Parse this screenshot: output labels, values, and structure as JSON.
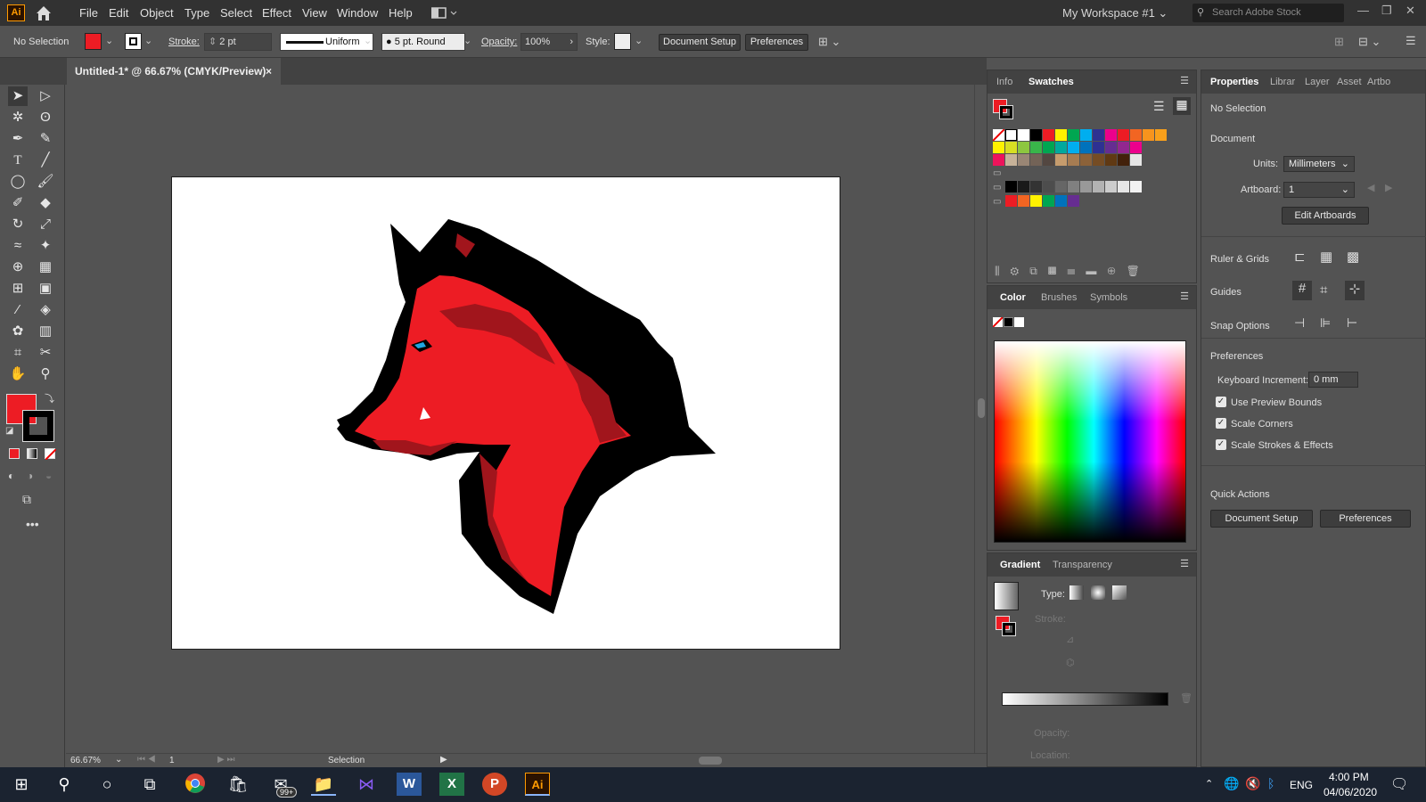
{
  "app": {
    "logo_text": "Ai",
    "menu": [
      "File",
      "Edit",
      "Object",
      "Type",
      "Select",
      "Effect",
      "View",
      "Window",
      "Help"
    ],
    "workspace": "My Workspace #1",
    "search_placeholder": "Search Adobe Stock"
  },
  "controlbar": {
    "selection": "No Selection",
    "stroke_label": "Stroke:",
    "stroke_weight": "2 pt",
    "stroke_profile": "Uniform",
    "brush": "5 pt. Round",
    "opacity_label": "Opacity:",
    "opacity": "100%",
    "style_label": "Style:",
    "document_setup": "Document Setup",
    "preferences": "Preferences"
  },
  "document": {
    "tab_title": "Untitled-1* @ 66.67% (CMYK/Preview)",
    "close": "×",
    "zoom": "66.67%",
    "artboard_num": "1",
    "status_tool": "Selection"
  },
  "swatches_panel": {
    "tabs": [
      "Info",
      "Swatches"
    ],
    "active": "Swatches",
    "colors_row1": [
      "#ffffff",
      "#000000",
      "#ed1c24",
      "#fff200",
      "#00a651",
      "#00aeef",
      "#2e3192",
      "#ec008c",
      "#ed1c24",
      "#f26522",
      "#f7941d",
      "#f9a01b"
    ],
    "colors_row2": [
      "#fff200",
      "#d7df23",
      "#8dc63f",
      "#39b54a",
      "#00a651",
      "#00a99d",
      "#00aeef",
      "#0072bc",
      "#2e3192",
      "#662d91",
      "#92278f",
      "#ec008c"
    ],
    "colors_row3": [
      "#ed145b",
      "#c7b299",
      "#998675",
      "#736357",
      "#534741",
      "#c69c6d",
      "#a67c52",
      "#8c6239",
      "#754c24",
      "#603913",
      "#42210b",
      "#e6e6e6"
    ],
    "grays": [
      "#000000",
      "#1a1a1a",
      "#333333",
      "#4d4d4d",
      "#666666",
      "#808080",
      "#999999",
      "#b3b3b3",
      "#cccccc",
      "#e6e6e6",
      "#f2f2f2"
    ],
    "brights": [
      "#ed1c24",
      "#f26522",
      "#fff200",
      "#00a651",
      "#0072bc",
      "#662d91"
    ]
  },
  "color_panel": {
    "tabs": [
      "Color",
      "Brushes",
      "Symbols"
    ]
  },
  "gradient_panel": {
    "tabs": [
      "Gradient",
      "Transparency"
    ],
    "type_label": "Type:",
    "stroke_label": "Stroke:",
    "opacity_label": "Opacity:",
    "location_label": "Location:"
  },
  "properties": {
    "tabs": [
      "Properties",
      "Librar",
      "Layer",
      "Asset",
      "Artbo"
    ],
    "selection": "No Selection",
    "document_heading": "Document",
    "units_label": "Units:",
    "units_value": "Millimeters",
    "artboard_label": "Artboard:",
    "artboard_value": "1",
    "edit_artboards": "Edit Artboards",
    "ruler_grids": "Ruler & Grids",
    "guides": "Guides",
    "snap_options": "Snap Options",
    "preferences_heading": "Preferences",
    "keyboard_increment_label": "Keyboard Increment:",
    "keyboard_increment_value": "0 mm",
    "use_preview_bounds": "Use Preview Bounds",
    "scale_corners": "Scale Corners",
    "scale_strokes": "Scale Strokes & Effects",
    "quick_actions": "Quick Actions",
    "document_setup": "Document Setup",
    "preferences": "Preferences"
  },
  "taskbar": {
    "badge": "99+",
    "lang": "ENG",
    "time": "4:00 PM",
    "date": "04/06/2020"
  },
  "colors": {
    "fill": "#ed1c24",
    "accent": "#ff9a00"
  }
}
